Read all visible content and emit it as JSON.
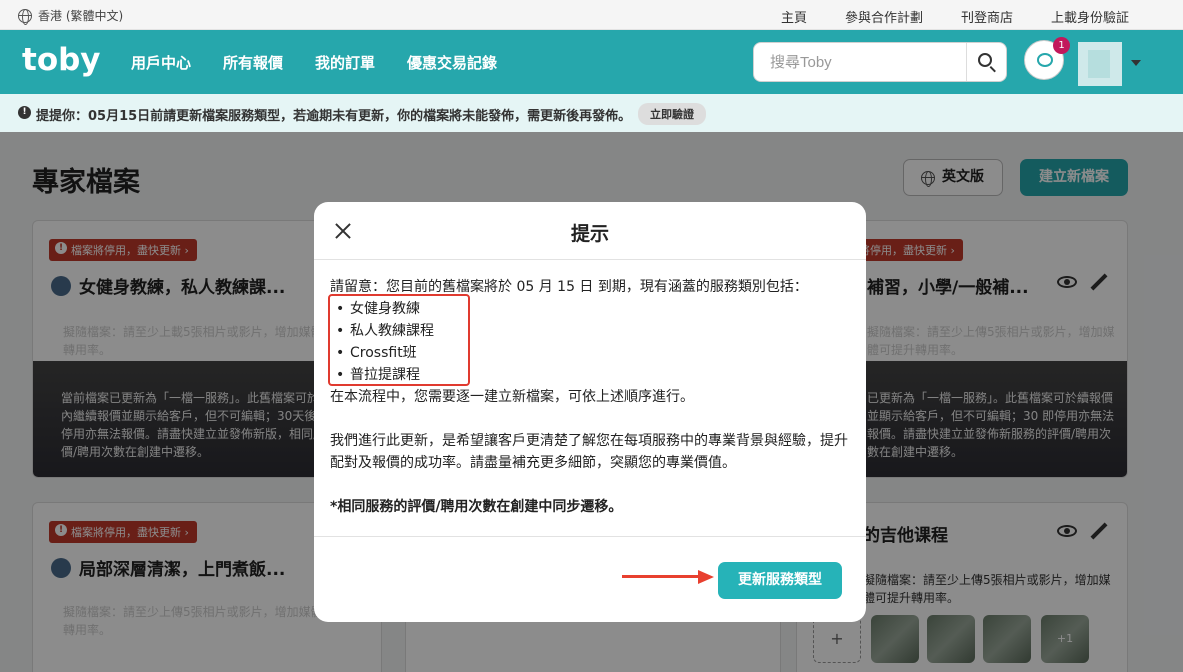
{
  "utilbar": {
    "language": "香港 (繁體中文)",
    "links": [
      "主頁",
      "參與合作計劃",
      "刊登商店",
      "上載身份驗証"
    ]
  },
  "nav": {
    "logo": "toby",
    "links": [
      "用戶中心",
      "所有報價",
      "我的訂單",
      "優惠交易記錄"
    ],
    "search_placeholder": "搜尋Toby",
    "chat_badge": "1",
    "accent": "#26a7ac"
  },
  "notice": {
    "text": "提提你：05月15日前請更新檔案服務類型，若逾期未有更新，你的檔案將未能發佈，需更新後再發佈。",
    "button": "立即驗證"
  },
  "page": {
    "title": "專家檔案",
    "english_button": "英文版",
    "new_button": "建立新檔案"
  },
  "cards": [
    {
      "tag": "檔案將停用，盡快更新 ›",
      "title": "女健身教練，私人教練課...",
      "faint": "擬隨檔案：請至少上載5張相片或影片，增加媒體可提升轉用率。",
      "dark": "當前檔案已更新為「一檔一服務」。此舊檔案可於30 天內繼續報價並顯示給客戶，但不可編輯；30天後將立即停用亦無法報價。請盡快建立並發佈新版，相同服務的評價/聘用次數在創建中遷移。"
    },
    {
      "tag": "檔案將停用，盡快更新 ›",
      "title": "補習，小學/一般補...",
      "faint": "擬隨檔案：請至少上傳5張相片或影片，增加媒體可提升轉用率。",
      "dark": "已更新為「一檔一服務」。此舊檔案可於續報價並顯示給客戶，但不可編輯；30 即停用亦無法報價。請盡快建立並發佈新服務的評價/聘用次數在創建中遷移。"
    },
    {
      "tag": "檔案將停用，盡快更新 ›",
      "title": "局部深層清潔，上門煮飯...",
      "faint": "擬隨檔案：請至少上傳5張相片或影片，增加媒體可提升轉用率。"
    },
    {
      "title": "的吉他课程",
      "faint": "擬隨檔案：請至少上傳5張相片或影片，增加媒體可提升轉用率。",
      "thumb_more": "+1"
    }
  ],
  "modal": {
    "title": "提示",
    "intro": "請留意：您目前的舊檔案將於 05 月 15 日 到期，現有涵蓋的服務類別包括：",
    "services": [
      "女健身教練",
      "私人教練課程",
      "Crossfit班",
      "普拉提課程"
    ],
    "step": "在本流程中，您需要逐一建立新檔案，可依上述順序進行。",
    "reason": "我們進行此更新，是希望讓客戶更清楚了解您在每項服務中的專業背景與經驗，提升配對及報價的成功率。請盡量補充更多細節，突顯您的專業價值。",
    "note": "*相同服務的評價/聘用次數在創建中同步遷移。",
    "button": "更新服務類型"
  }
}
